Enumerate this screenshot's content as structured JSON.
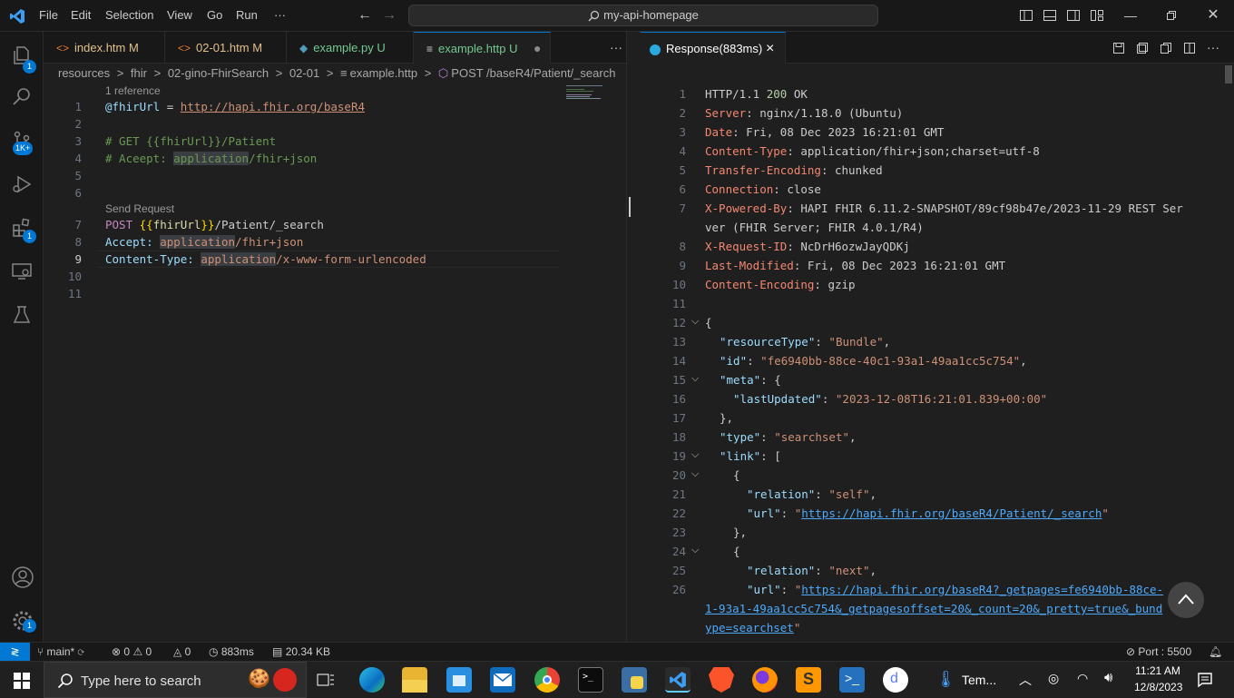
{
  "menu": {
    "file": "File",
    "edit": "Edit",
    "selection": "Selection",
    "view": "View",
    "go": "Go",
    "run": "Run",
    "more": "···"
  },
  "command_center": {
    "text": "my-api-homepage"
  },
  "activity": {
    "explorer_badge": "1",
    "scm_badge": "1K+",
    "extensions_badge": "1",
    "manage_badge": "1"
  },
  "tabs_left": [
    {
      "label": "index.htm",
      "status": "M"
    },
    {
      "label": "02-01.htm",
      "status": "M"
    },
    {
      "label": "example.py",
      "status": "U"
    },
    {
      "label": "example.http",
      "status": "U"
    }
  ],
  "tabs_more": "···",
  "breadcrumb": {
    "p1": "resources",
    "p2": "fhir",
    "p3": "02-gino-FhirSearch",
    "p4": "02-01",
    "p5": "example.http",
    "p6": "POST /baseR4/Patient/_search",
    "sep": ">"
  },
  "editor": {
    "codelens_ref": "1 reference",
    "codelens_send": "Send Request",
    "line_numbers": [
      "1",
      "2",
      "3",
      "4",
      "5",
      "6",
      "7",
      "8",
      "9",
      "10",
      "11"
    ],
    "l1_var": "@fhirUrl",
    "l1_eq": " = ",
    "l1_url": "http://hapi.fhir.org/baseR4",
    "l3": "# GET {{fhirUrl}}/Patient",
    "l4_a": "# Aceept: ",
    "l4_b": "application",
    "l4_c": "/fhir+json",
    "l7_a": "POST ",
    "l7_b": "{{",
    "l7_c": "fhirUrl",
    "l7_d": "}}",
    "l7_e": "/Patient/_search",
    "l8_a": "Accept: ",
    "l8_b": "application",
    "l8_c": "/fhir+json",
    "l9_a": "Content-Type: ",
    "l9_b": "application",
    "l9_c": "/x-www-form-urlencoded"
  },
  "response_tab": {
    "label": "Response(883ms)",
    "close": "×"
  },
  "response": {
    "line_numbers": [
      "1",
      "2",
      "3",
      "4",
      "5",
      "6",
      "7",
      "8",
      "9",
      "10",
      "11",
      "12",
      "13",
      "14",
      "15",
      "16",
      "17",
      "18",
      "19",
      "20",
      "21",
      "22",
      "23",
      "24",
      "25",
      "26"
    ],
    "l1_a": "HTTP/1.1 ",
    "l1_b": "200",
    "l1_c": " OK",
    "l2_k": "Server",
    "l2_v": ": nginx/1.18.0 (Ubuntu)",
    "l3_k": "Date",
    "l3_v": ": Fri, 08 Dec 2023 16:21:01 GMT",
    "l4_k": "Content-Type",
    "l4_v": ": application/fhir+json;charset=utf-8",
    "l5_k": "Transfer-Encoding",
    "l5_v": ": chunked",
    "l6_k": "Connection",
    "l6_v": ": close",
    "l7_k": "X-Powered-By",
    "l7_v": ": HAPI FHIR 6.11.2-SNAPSHOT/89cf98b47e/2023-11-29 REST Ser",
    "l7_wrap": "ver (FHIR Server; FHIR 4.0.1/R4)",
    "l8_k": "X-Request-ID",
    "l8_v": ": NcDrH6ozwJayQDKj",
    "l9_k": "Last-Modified",
    "l9_v": ": Fri, 08 Dec 2023 16:21:01 GMT",
    "l10_k": "Content-Encoding",
    "l10_v": ": gzip",
    "l12": "{",
    "l13_k": "\"resourceType\"",
    "l13_v": "\"Bundle\"",
    "l14_k": "\"id\"",
    "l14_v": "\"fe6940bb-88ce-40c1-93a1-49aa1cc5c754\"",
    "l15_k": "\"meta\"",
    "l15_v": "{",
    "l16_k": "\"lastUpdated\"",
    "l16_v": "\"2023-12-08T16:21:01.839+00:00\"",
    "l17": "},",
    "l18_k": "\"type\"",
    "l18_v": "\"searchset\"",
    "l19_k": "\"link\"",
    "l19_v": "[",
    "l20": "{",
    "l21_k": "\"relation\"",
    "l21_v": "\"self\"",
    "l22_k": "\"url\"",
    "l22_q": "\"",
    "l22_v": "https://hapi.fhir.org/baseR4/Patient/_search",
    "l23": "},",
    "l24": "{",
    "l25_k": "\"relation\"",
    "l25_v": "\"next\"",
    "l26_k": "\"url\"",
    "l26_q": "\"",
    "l26_v": "https://hapi.fhir.org/baseR4?_getpages=fe6940bb-88ce-",
    "l26_w1": "1-93a1-49aa1cc5c754&_getpagesoffset=20&_count=20&_pretty=true&_bund",
    "l26_w2": "ype=searchset",
    "l26_w2q": "\""
  },
  "statusbar": {
    "branch": "main*",
    "errors": "0",
    "warnings": "0",
    "info": "0",
    "time": "883ms",
    "size": "20.34 KB",
    "port": "Port : 5500"
  },
  "taskbar": {
    "search_placeholder": "Type here to search",
    "weather": "Tem...",
    "time": "11:21 AM",
    "date": "12/8/2023"
  },
  "colors": {
    "accent": "#0078d4",
    "bg": "#1f1f1f"
  }
}
